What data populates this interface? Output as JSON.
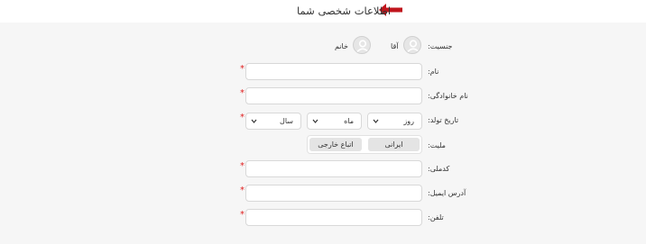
{
  "header": {
    "title": "اطلاعات شخصی شما"
  },
  "form": {
    "gender": {
      "label": "جنسیت:",
      "options": [
        {
          "label": "آقا"
        },
        {
          "label": "خانم"
        }
      ]
    },
    "first_name": {
      "label": "نام:",
      "value": "",
      "required_mark": "*"
    },
    "last_name": {
      "label": "نام خانوادگی:",
      "value": "",
      "required_mark": "*"
    },
    "birth_date": {
      "label": "تاریخ تولد:",
      "required_mark": "*",
      "day": "روز",
      "month": "ماه",
      "year": "سال"
    },
    "nationality": {
      "label": "ملیت:",
      "options": [
        {
          "label": "ایرانی"
        },
        {
          "label": "اتباع خارجی"
        }
      ]
    },
    "national_code": {
      "label": "کدملی:",
      "value": "",
      "required_mark": "*"
    },
    "email": {
      "label": "آدرس ایمیل:",
      "value": "",
      "required_mark": "*"
    },
    "phone": {
      "label": "تلفن:",
      "value": "",
      "required_mark": "*"
    }
  },
  "colors": {
    "accent_arrow": "#c0161d",
    "required": "#e02020",
    "panel_bg": "#f6f6f6"
  },
  "icons": {
    "title_arrow": "arrow-left-icon",
    "avatar": "user-avatar-icon",
    "chevron": "chevron-down-icon"
  }
}
